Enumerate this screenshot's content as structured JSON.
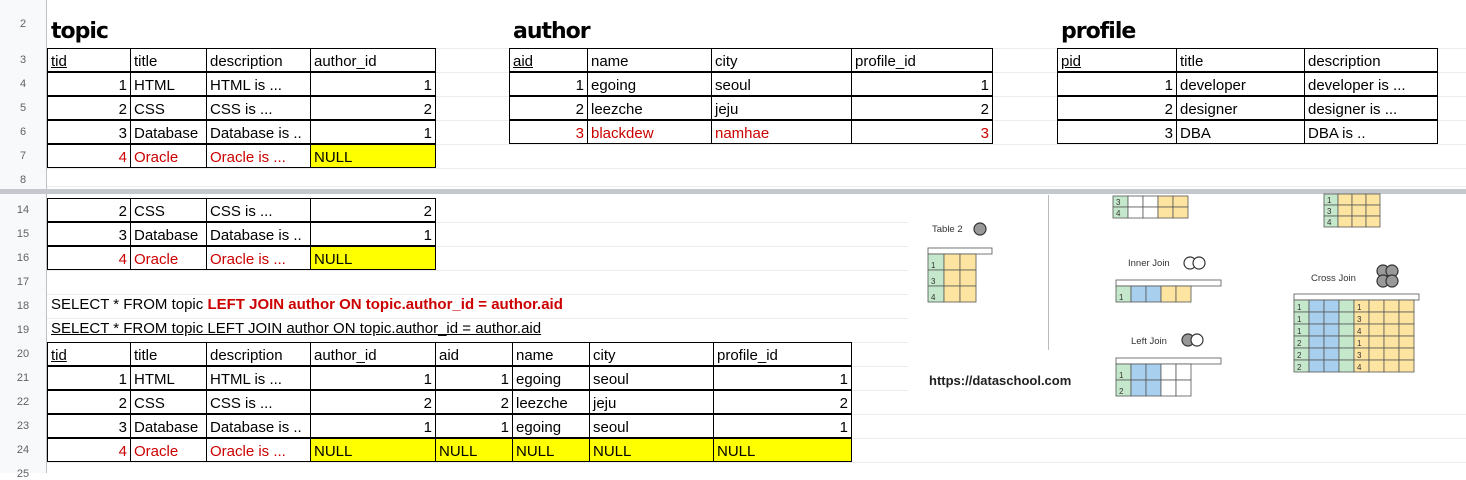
{
  "row_numbers": [
    "2",
    "3",
    "4",
    "5",
    "6",
    "7",
    "8",
    "14",
    "15",
    "16",
    "17",
    "18",
    "19",
    "20",
    "21",
    "22",
    "23",
    "24",
    "25"
  ],
  "titles": {
    "topic": "topic",
    "author": "author",
    "profile": "profile"
  },
  "topic": {
    "headers": [
      "tid",
      "title",
      "description",
      "author_id"
    ],
    "rows": [
      [
        "1",
        "HTML",
        "HTML is ...",
        "1"
      ],
      [
        "2",
        "CSS",
        "CSS is ...",
        "2"
      ],
      [
        "3",
        "Database",
        "Database is ..",
        "1"
      ],
      [
        "4",
        "Oracle",
        "Oracle is ...",
        "NULL"
      ]
    ]
  },
  "author": {
    "headers": [
      "aid",
      "name",
      "city",
      "profile_id"
    ],
    "rows": [
      [
        "1",
        "egoing",
        "seoul",
        "1"
      ],
      [
        "2",
        "leezche",
        "jeju",
        "2"
      ],
      [
        "3",
        "blackdew",
        "namhae",
        "3"
      ]
    ]
  },
  "profile": {
    "headers": [
      "pid",
      "title",
      "description"
    ],
    "rows": [
      [
        "1",
        "developer",
        "developer is ..."
      ],
      [
        "2",
        "designer",
        "designer is ..."
      ],
      [
        "3",
        "DBA",
        "DBA is .."
      ]
    ]
  },
  "lower_topic_rows": [
    [
      "2",
      "CSS",
      "CSS is ...",
      "2"
    ],
    [
      "3",
      "Database",
      "Database is ..",
      "1"
    ],
    [
      "4",
      "Oracle",
      "Oracle is ...",
      "NULL"
    ]
  ],
  "sql1": {
    "prefix": "SELECT * FROM topic ",
    "keyword": "LEFT JOIN author ON topic.author_id = author.aid"
  },
  "sql2": "SELECT * FROM topic LEFT JOIN author ON topic.author_id = author.aid",
  "result": {
    "headers": [
      "tid",
      "title",
      "description",
      "author_id",
      "aid",
      "name",
      "city",
      "profile_id"
    ],
    "rows": [
      [
        "1",
        "HTML",
        "HTML is ...",
        "1",
        "1",
        "egoing",
        "seoul",
        "1"
      ],
      [
        "2",
        "CSS",
        "CSS is ...",
        "2",
        "2",
        "leezche",
        "jeju",
        "2"
      ],
      [
        "3",
        "Database",
        "Database is ..",
        "1",
        "1",
        "egoing",
        "seoul",
        "1"
      ],
      [
        "4",
        "Oracle",
        "Oracle is ...",
        "NULL",
        "NULL",
        "NULL",
        "NULL",
        "NULL"
      ]
    ]
  },
  "diagram": {
    "table2_label": "Table 2",
    "inner_join_label": "Inner Join",
    "left_join_label": "Left Join",
    "cross_join_label": "Cross Join",
    "source": "https://dataschool.com",
    "colors": {
      "green": "#c5e8cc",
      "yellow": "#fde4a1",
      "blue": "#a9cfee",
      "grid": "#555555"
    }
  },
  "colors": {
    "null_fill": "#ffff00",
    "missing_text": "#cc0000"
  }
}
